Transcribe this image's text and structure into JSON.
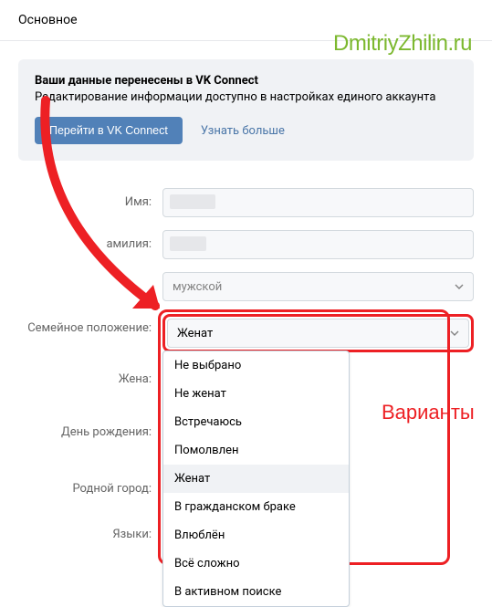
{
  "page": {
    "title": "Основное"
  },
  "watermark": "DmitriyZhilin.ru",
  "notice": {
    "title": "Ваши данные перенесены в VK Connect",
    "desc": "Редактирование информации доступно в настройках единого аккаунта",
    "go_button": "Перейти в VK Connect",
    "more_link": "Узнать больше"
  },
  "labels": {
    "name": "Имя:",
    "surname": "амилия:",
    "gender_value": "мужской",
    "marital": "Семейное положение:",
    "marital_value": "Женат",
    "wife": "Жена:",
    "birthday": "День рождения:",
    "hometown": "Родной город:",
    "languages": "Языки:"
  },
  "marital_options": [
    "Не выбрано",
    "Не женат",
    "Встречаюсь",
    "Помолвлен",
    "Женат",
    "В гражданском браке",
    "Влюблён",
    "Всё сложно",
    "В активном поиске"
  ],
  "annotation": {
    "variants": "Варианты"
  }
}
